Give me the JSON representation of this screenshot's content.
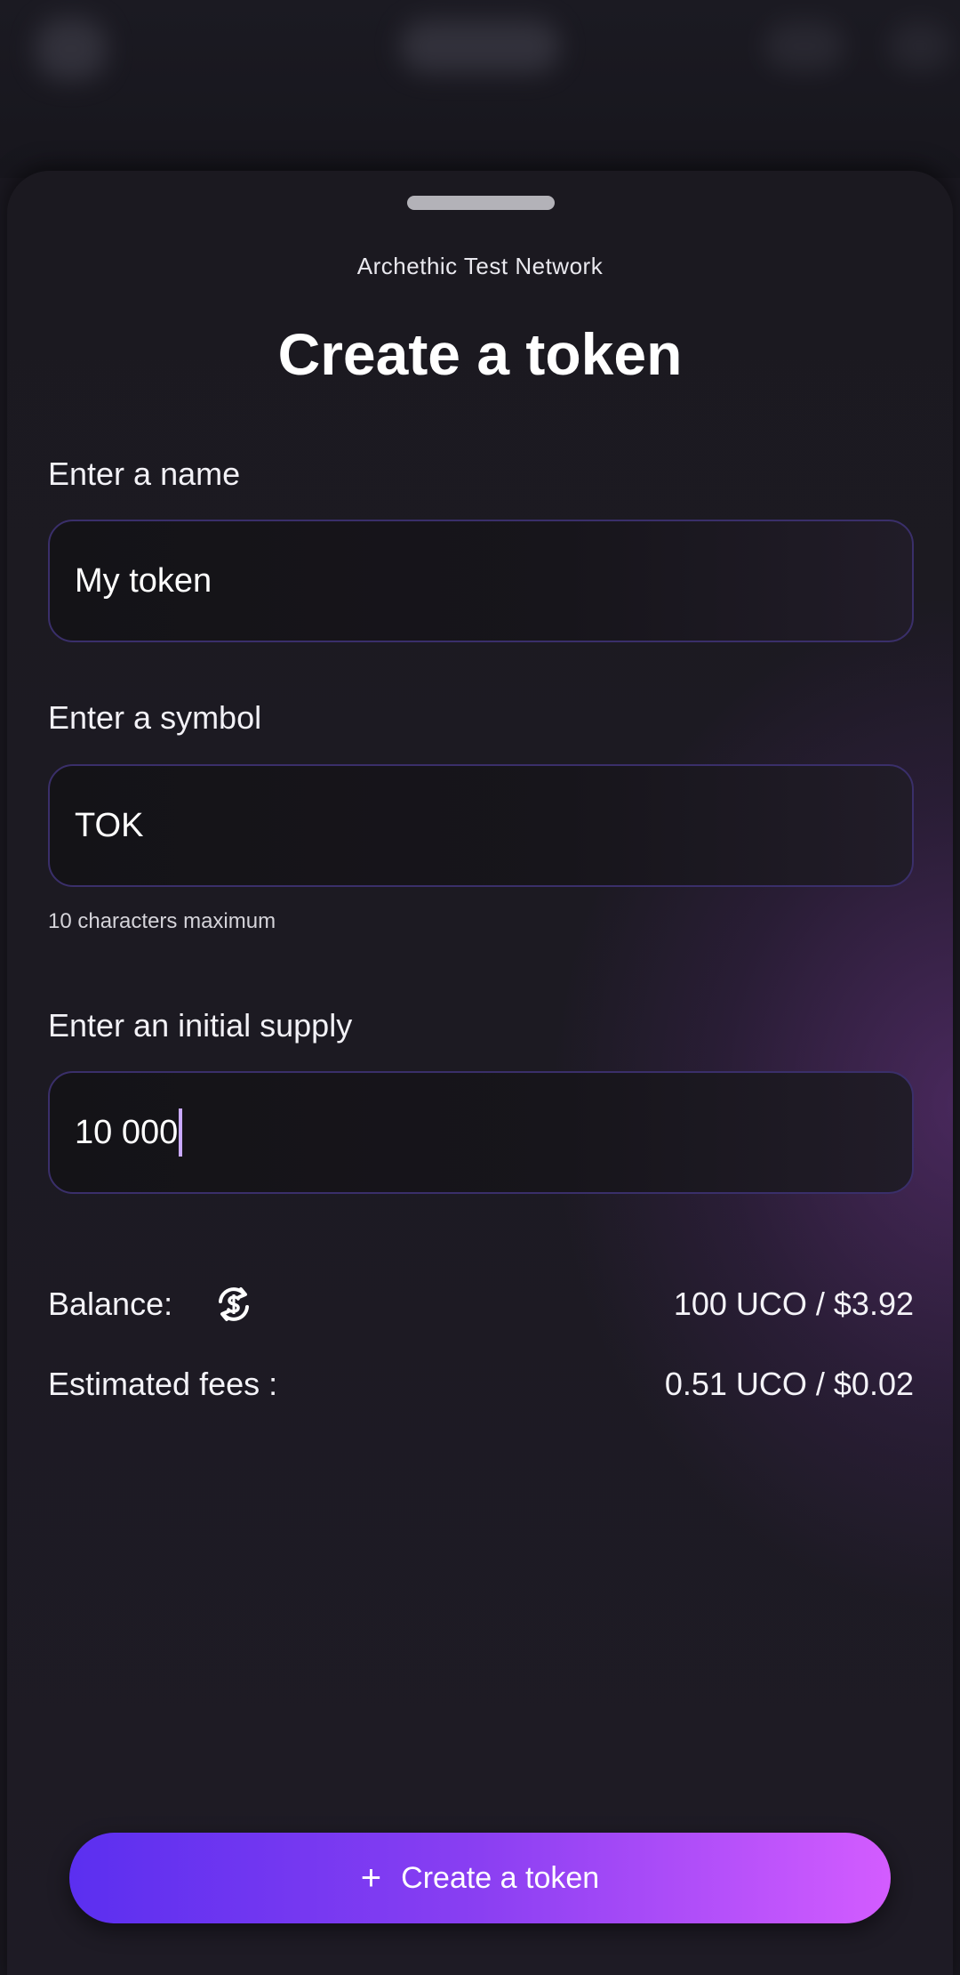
{
  "sheet": {
    "network": "Archethic Test Network",
    "title": "Create a token"
  },
  "form": {
    "name": {
      "label": "Enter a name",
      "value": "My token"
    },
    "symbol": {
      "label": "Enter a symbol",
      "value": "TOK",
      "hint": "10 characters maximum"
    },
    "supply": {
      "label": "Enter an initial supply",
      "value": "10 000"
    }
  },
  "summary": {
    "balance_label": "Balance:",
    "balance_value": "100 UCO / $3.92",
    "fees_label": "Estimated fees :",
    "fees_value": "0.51 UCO / $0.02"
  },
  "actions": {
    "create_label": "Create a token",
    "create_icon": "plus-icon"
  },
  "icons": {
    "refresh": "currency-swap-icon",
    "handle": "drag-handle"
  },
  "colors": {
    "accent_start": "#5b2ff0",
    "accent_end": "#d35cff",
    "field_border": "#3a2f6a",
    "background": "#1a1820"
  }
}
